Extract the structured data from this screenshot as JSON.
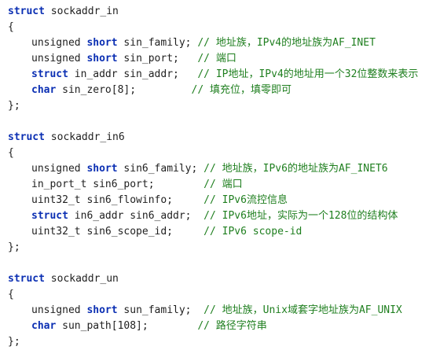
{
  "blocks": [
    {
      "head_kw": "struct",
      "head_name": " sockaddr_in",
      "open": "{",
      "close": "};",
      "members": [
        {
          "k1": "unsigned",
          "k2": " short",
          "k3": "",
          "rest": " sin_family; ",
          "comment": "// 地址族，IPv4的地址族为AF_INET"
        },
        {
          "k1": "unsigned",
          "k2": " short",
          "k3": "",
          "rest": " sin_port;   ",
          "comment": "// 端口"
        },
        {
          "k1": "struct",
          "k2": "",
          "k3": "",
          "rest": " in_addr sin_addr;   ",
          "comment": "// IP地址，IPv4的地址用一个32位整数来表示"
        },
        {
          "k1": "char",
          "k2": "",
          "k3": "",
          "rest": " sin_zero[8];         ",
          "comment": "// 填充位，填零即可"
        }
      ]
    },
    {
      "head_kw": "struct",
      "head_name": " sockaddr_in6",
      "open": "{",
      "close": "};",
      "members": [
        {
          "k1": "unsigned",
          "k2": " short",
          "k3": "",
          "rest": " sin6_family; ",
          "comment": "// 地址族，IPv6的地址族为AF_INET6"
        },
        {
          "k1": "",
          "k2": "",
          "k3": "",
          "rest": "in_port_t sin6_port;        ",
          "comment": "// 端口"
        },
        {
          "k1": "",
          "k2": "",
          "k3": "",
          "rest": "uint32_t sin6_flowinfo;     ",
          "comment": "// IPv6流控信息"
        },
        {
          "k1": "struct",
          "k2": "",
          "k3": "",
          "rest": " in6_addr sin6_addr;  ",
          "comment": "// IPv6地址，实际为一个128位的结构体"
        },
        {
          "k1": "",
          "k2": "",
          "k3": "",
          "rest": "uint32_t sin6_scope_id;     ",
          "comment": "// IPv6 scope-id"
        }
      ]
    },
    {
      "head_kw": "struct",
      "head_name": " sockaddr_un",
      "open": "{",
      "close": "};",
      "members": [
        {
          "k1": "unsigned",
          "k2": " short",
          "k3": "",
          "rest": " sun_family;  ",
          "comment": "// 地址族，Unix域套字地址族为AF_UNIX"
        },
        {
          "k1": "char",
          "k2": "",
          "k3": "",
          "rest": " sun_path[108];        ",
          "comment": "// 路径字符串"
        }
      ]
    }
  ]
}
